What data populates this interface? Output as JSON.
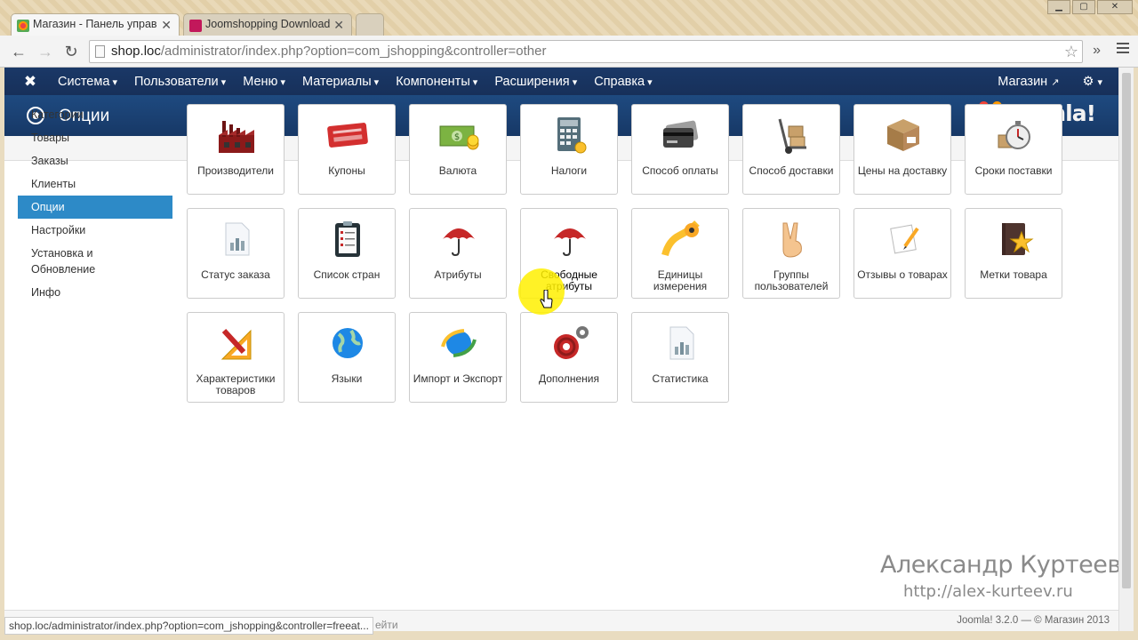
{
  "browser": {
    "tabs": [
      {
        "title": "Магазин - Панель управ",
        "active": true
      },
      {
        "title": "Joomshopping Download",
        "active": false
      }
    ],
    "url_host": "shop.loc",
    "url_path": "/administrator/index.php?option=com_jshopping&controller=other",
    "status_url": "shop.loc/administrator/index.php?option=com_jshopping&controller=freeat...",
    "status_tail": "ейти"
  },
  "topnav": {
    "items": [
      "Система",
      "Пользователи",
      "Меню",
      "Материалы",
      "Компоненты",
      "Расширения",
      "Справка"
    ],
    "site_link": "Магазин",
    "brand": "Joomla!"
  },
  "header": {
    "title": "Опции"
  },
  "sidebar": {
    "items": [
      "Категории",
      "Товары",
      "Заказы",
      "Клиенты",
      "Опции",
      "Настройки",
      "Установка и Обновление",
      "Инфо"
    ],
    "active_index": 4
  },
  "tiles": [
    {
      "label": "Производители",
      "icon": "factory-icon"
    },
    {
      "label": "Купоны",
      "icon": "coupon-icon"
    },
    {
      "label": "Валюта",
      "icon": "money-icon"
    },
    {
      "label": "Налоги",
      "icon": "calculator-icon"
    },
    {
      "label": "Способ оплаты",
      "icon": "credit-card-icon"
    },
    {
      "label": "Способ доставки",
      "icon": "hand-truck-icon"
    },
    {
      "label": "Цены на доставку",
      "icon": "box-icon"
    },
    {
      "label": "Сроки поставки",
      "icon": "stopwatch-icon"
    },
    {
      "label": "Статус заказа",
      "icon": "document-chart-icon"
    },
    {
      "label": "Список стран",
      "icon": "clipboard-icon"
    },
    {
      "label": "Атрибуты",
      "icon": "umbrella-icon"
    },
    {
      "label": "Свободные атрибуты",
      "icon": "umbrella-icon"
    },
    {
      "label": "Единицы измерения",
      "icon": "tape-measure-icon"
    },
    {
      "label": "Группы пользователей",
      "icon": "victory-hand-icon"
    },
    {
      "label": "Отзывы о товарах",
      "icon": "note-pencil-icon"
    },
    {
      "label": "Метки товара",
      "icon": "star-book-icon"
    },
    {
      "label": "Характеристики товаров",
      "icon": "ruler-pencil-icon"
    },
    {
      "label": "Языки",
      "icon": "globe-icon"
    },
    {
      "label": "Импорт и Экспорт",
      "icon": "globe-sync-icon"
    },
    {
      "label": "Дополнения",
      "icon": "gears-icon"
    },
    {
      "label": "Статистика",
      "icon": "document-chart-icon"
    }
  ],
  "watermark": {
    "name": "Александр Куртеев",
    "site": "http://alex-kurteev.ru"
  },
  "footer": {
    "copyright": "Joomla! 3.2.0  —  © Магазин 2013"
  },
  "colors": {
    "nav_bg": "#1a3867",
    "header_bg": "#1e4a80",
    "active_bg": "#2d8ac7"
  }
}
